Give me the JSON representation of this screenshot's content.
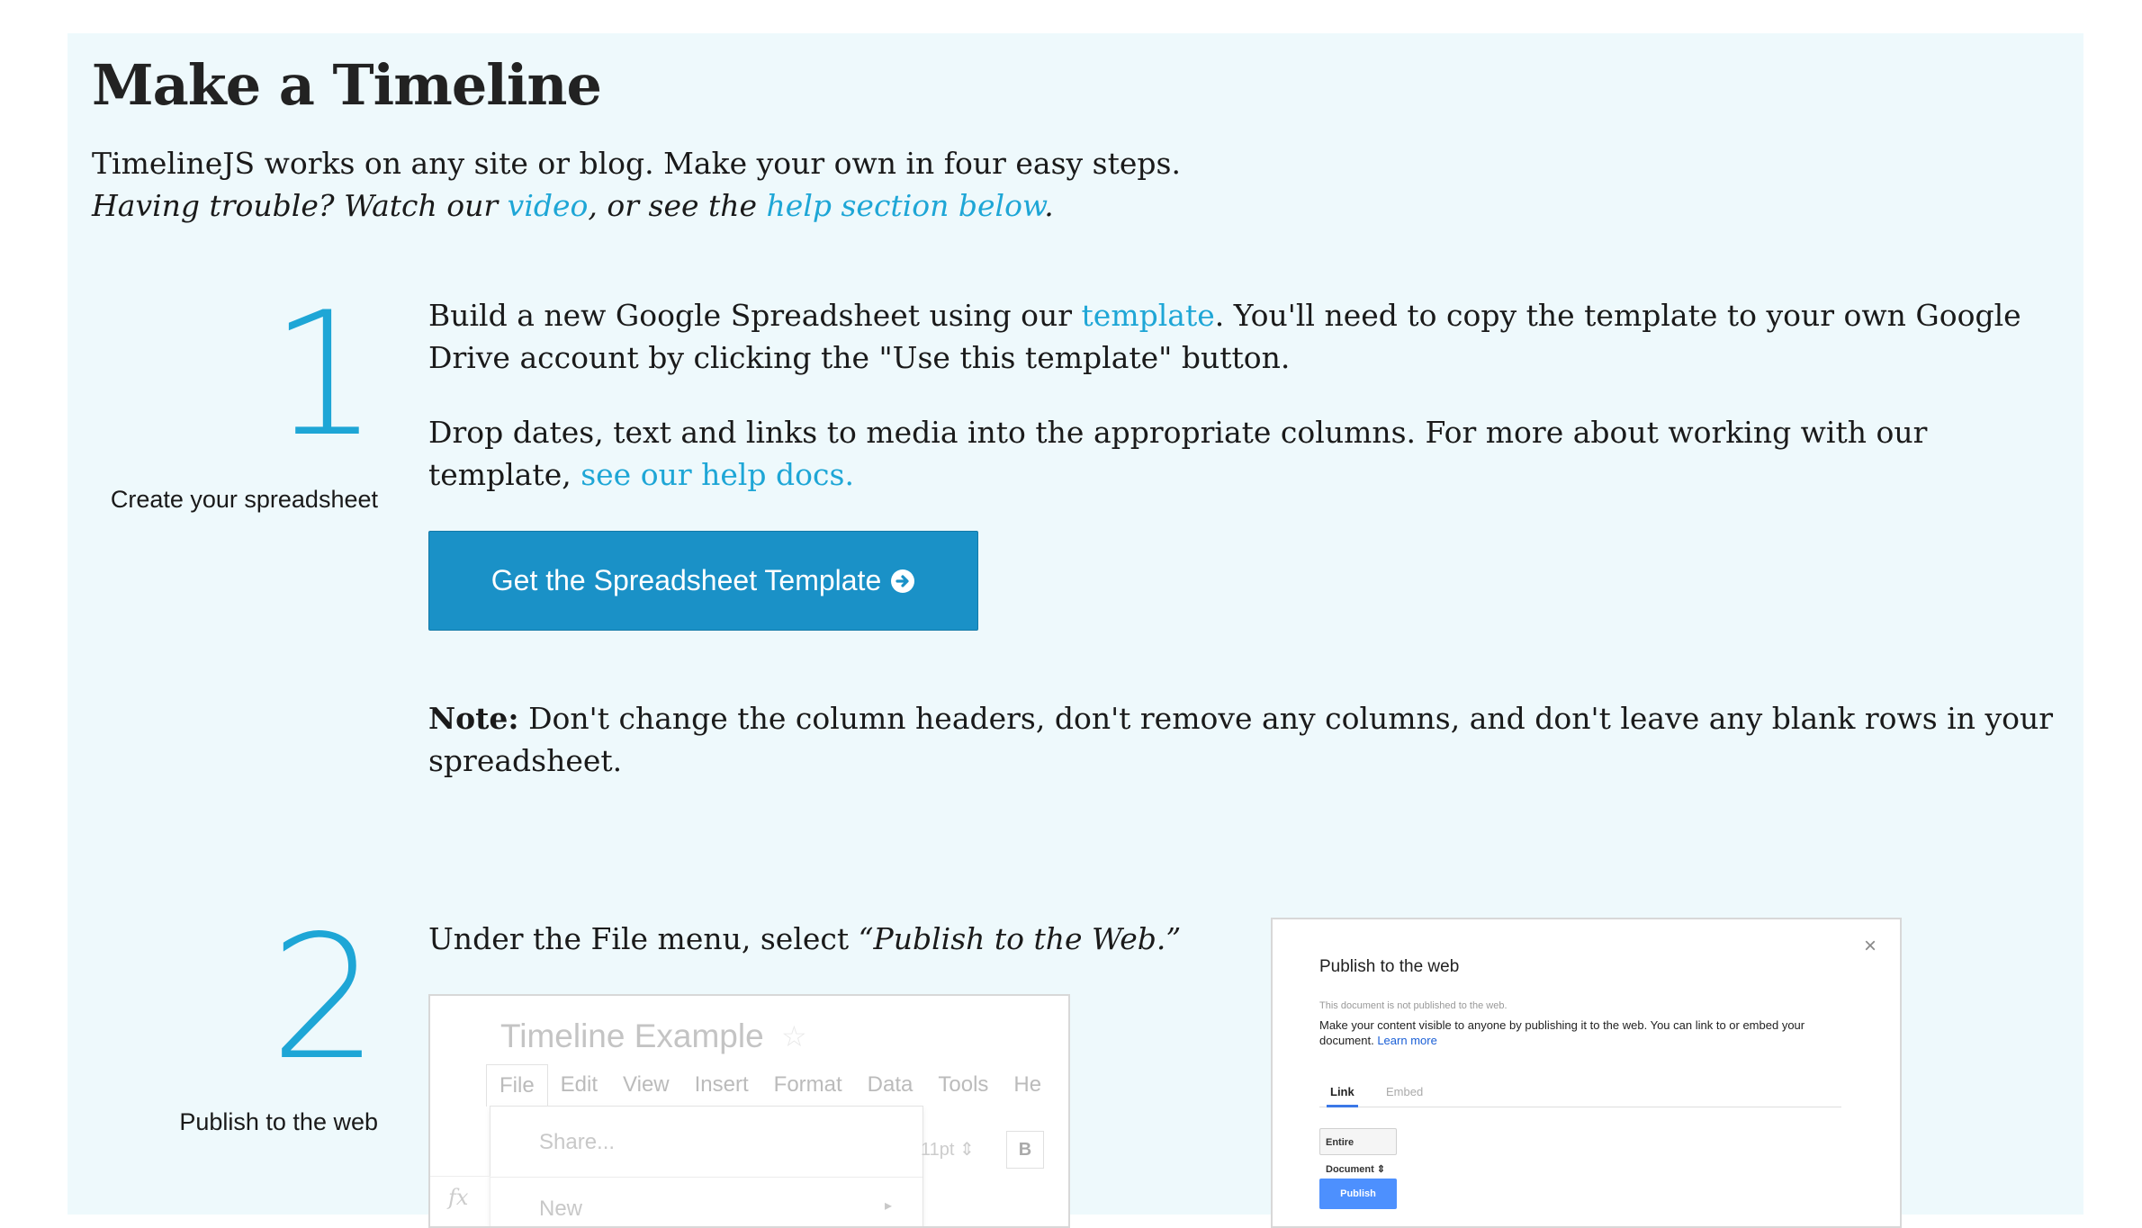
{
  "header": {
    "title": "Make a Timeline",
    "intro_text": "TimelineJS works on any site or blog. Make your own in four easy steps.",
    "trouble_prefix": "Having trouble? Watch our ",
    "video_link": "video",
    "trouble_middle": ", or see the ",
    "help_link": "help section below",
    "trouble_suffix": "."
  },
  "step1": {
    "number": "1",
    "label": "Create your spreadsheet",
    "p1_prefix": "Build a new Google Spreadsheet using our ",
    "p1_link": "template",
    "p1_suffix": ". You'll need to copy the template to your own Google Drive account by clicking the \"Use this template\" button.",
    "p2_prefix": "Drop dates, text and links to media into the appropriate columns. For more about working with our template, ",
    "p2_link": "see our help docs.",
    "button_label": "Get the Spreadsheet Template",
    "button_icon": "arrow-circle-right-icon",
    "note_label": "Note:",
    "note_text": " Don't change the column headers, don't remove any columns, and don't leave any blank rows in your spreadsheet."
  },
  "step2": {
    "number": "2",
    "label": "Publish to the web",
    "instruction_prefix": "Under the File menu, select ",
    "instruction_em": "“Publish to the Web.”",
    "sheet_mock": {
      "doc_title": "Timeline Example",
      "menu_items": [
        "File",
        "Edit",
        "View",
        "Insert",
        "Format",
        "Data",
        "Tools",
        "He"
      ],
      "dropdown_items": [
        "Share...",
        "New"
      ],
      "font_size": "11pt",
      "bold": "B",
      "fx": "fx"
    },
    "dialog_mock": {
      "title": "Publish to the web",
      "close": "×",
      "status": "This document is not published to the web.",
      "desc": "Make your content visible to anyone by publishing it to the web. You can link to or embed your document.",
      "learn_more": "Learn more",
      "tab_link": "Link",
      "tab_embed": "Embed",
      "select_value": "Entire Document",
      "publish": "Publish"
    }
  },
  "colors": {
    "panel_bg": "#eef9fc",
    "accent": "#1ea6d6",
    "button_bg": "#1a91c7"
  }
}
